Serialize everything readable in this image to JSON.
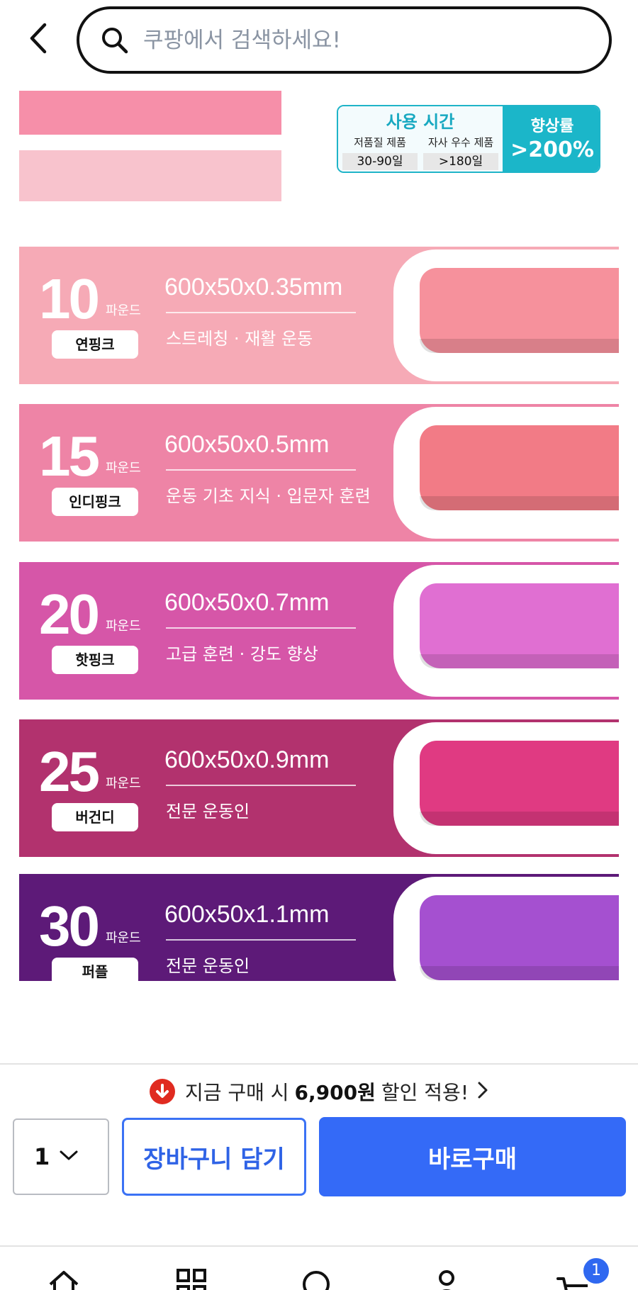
{
  "header": {
    "search_placeholder": "쿠팡에서 검색하세요!"
  },
  "colors": {
    "accent": "#346af7",
    "discount_icon": "#e02b20",
    "usage_teal": "#1bb6c9"
  },
  "detail_image": {
    "usage_box": {
      "title": "사용 시간",
      "col1_header": "저품질 제품",
      "col1_value": "30-90일",
      "col2_header": "자사 우수 제품",
      "col2_value": ">180일",
      "improve_label": "향상률",
      "improve_value": ">200%"
    },
    "bands": [
      {
        "weight": "10",
        "unit": "파운드",
        "color_name": "연핑크",
        "size": "600x50x0.35mm",
        "use": "스트레칭 · 재활 운동",
        "bg": "#f6aab6",
        "band_color": "#f6919c"
      },
      {
        "weight": "15",
        "unit": "파운드",
        "color_name": "인디핑크",
        "size": "600x50x0.5mm",
        "use": "운동 기초 지식 · 입문자 훈련",
        "bg": "#ee84a6",
        "band_color": "#f27b86"
      },
      {
        "weight": "20",
        "unit": "파운드",
        "color_name": "핫핑크",
        "size": "600x50x0.7mm",
        "use": "고급 훈련 · 강도 향상",
        "bg": "#d656a8",
        "band_color": "#e06fd2"
      },
      {
        "weight": "25",
        "unit": "파운드",
        "color_name": "버건디",
        "size": "600x50x0.9mm",
        "use": "전문 운동인",
        "bg": "#b2326e",
        "band_color": "#e03a82"
      },
      {
        "weight": "30",
        "unit": "파운드",
        "color_name": "퍼플",
        "size": "600x50x1.1mm",
        "use": "전문 운동인",
        "bg": "#5d1a78",
        "band_color": "#a550d0"
      }
    ]
  },
  "discount": {
    "prefix": "지금 구매 시",
    "amount": "6,900원",
    "suffix": "할인 적용!"
  },
  "purchase": {
    "quantity": "1",
    "cart_label": "장바구니 담기",
    "buy_label": "바로구매"
  },
  "nav": {
    "cart_badge": "1",
    "items": [
      "home-icon",
      "category-icon",
      "search-icon",
      "mypage-icon",
      "cart-icon"
    ]
  }
}
